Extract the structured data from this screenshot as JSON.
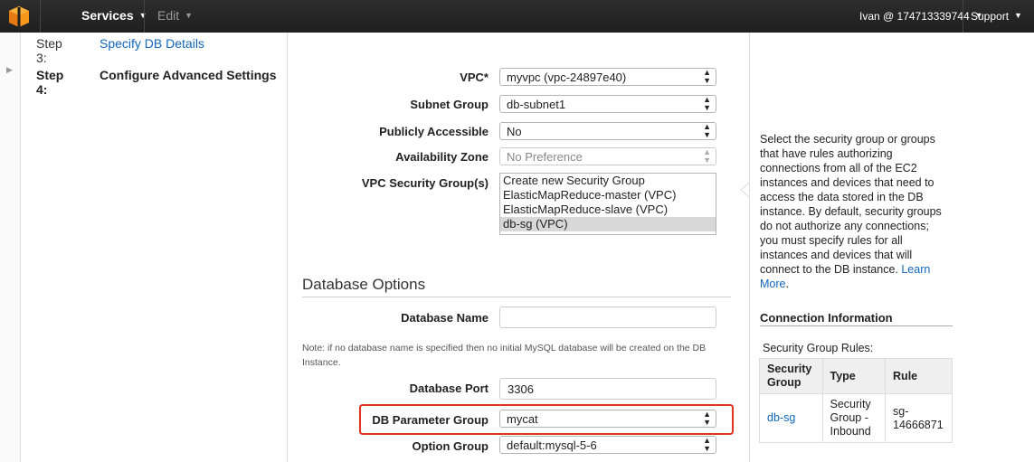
{
  "topbar": {
    "services_label": "Services",
    "edit_label": "Edit",
    "account_label": "Ivan @ 174713339744",
    "support_label": "Support",
    "logo_color": "#f90"
  },
  "steps": [
    {
      "num": "Step 3:",
      "label": "Specify DB Details"
    },
    {
      "num": "Step 4:",
      "label": "Configure Advanced Settings"
    }
  ],
  "network": {
    "vpc_label": "VPC*",
    "vpc_value": "myvpc (vpc-24897e40)",
    "subnet_label": "Subnet Group",
    "subnet_value": "db-subnet1",
    "public_label": "Publicly Accessible",
    "public_value": "No",
    "az_label": "Availability Zone",
    "az_value": "No Preference",
    "sg_label": "VPC Security Group(s)",
    "sg_options": [
      "Create new Security Group",
      "ElasticMapReduce-master (VPC)",
      "ElasticMapReduce-slave (VPC)",
      "db-sg (VPC)"
    ],
    "sg_selected": "db-sg (VPC)"
  },
  "database": {
    "section_title": "Database Options",
    "name_label": "Database Name",
    "name_value": "",
    "note": "Note: if no database name is specified then no initial MySQL database will be created on the DB Instance.",
    "port_label": "Database Port",
    "port_value": "3306",
    "param_group_label": "DB Parameter Group",
    "param_group_value": "mycat",
    "option_group_label": "Option Group",
    "option_group_value": "default:mysql-5-6"
  },
  "help": {
    "text": "Select the security group or groups that have rules authorizing connections from all of the EC2 instances and devices that need to access the data stored in the DB instance. By default, security groups do not authorize any connections; you must specify rules for all instances and devices that will connect to the DB instance.",
    "learn_more": "Learn More",
    "period": "."
  },
  "connection": {
    "title": "Connection Information",
    "rules_label": "Security Group Rules:",
    "headers": [
      "Security Group",
      "Type",
      "Rule"
    ],
    "row": {
      "group": "db-sg",
      "type": "Security Group - Inbound",
      "rule": "sg-14666871"
    }
  },
  "colors": {
    "highlight": "#e1341e",
    "link": "#1166bb",
    "topbar": "#232323"
  }
}
